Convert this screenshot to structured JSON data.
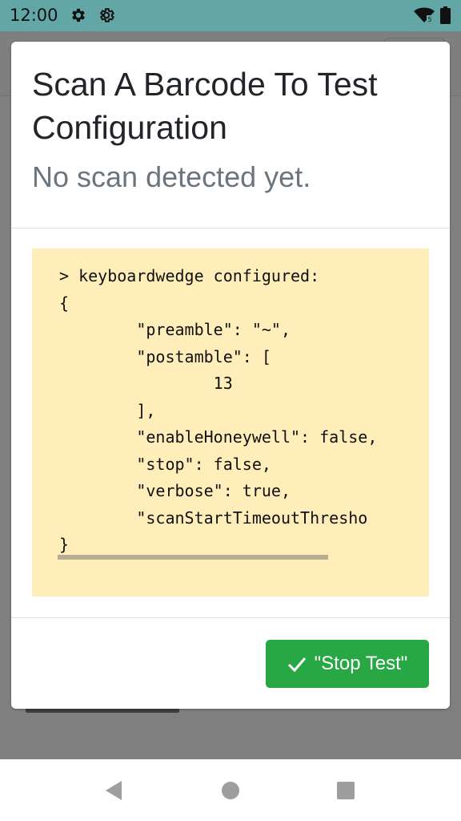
{
  "status_bar": {
    "time": "12:00",
    "icons": [
      "settings-gear-icon",
      "settings-gear-icon",
      "wifi-icon",
      "battery-icon"
    ]
  },
  "dialog": {
    "title": "Scan A Barcode To Test Configuration",
    "subtitle": "No scan detected yet.",
    "console_text": "> keyboardwedge configured:\n{\n        \"preamble\": \"~\",\n        \"postamble\": [\n                13\n        ],\n        \"enableHoneywell\": false,\n        \"stop\": false,\n        \"verbose\": true,\n        \"scanStartTimeoutThresho\n}",
    "stop_button_label": "\"Stop Test\""
  },
  "colors": {
    "status_bar": "#63a6a6",
    "console_bg": "#ffeeba",
    "stop_button": "#28a745",
    "title_text": "#212529",
    "subtitle_text": "#6c757d"
  },
  "nav_bar": {
    "icons": [
      "back-icon",
      "home-icon",
      "recents-icon"
    ]
  }
}
